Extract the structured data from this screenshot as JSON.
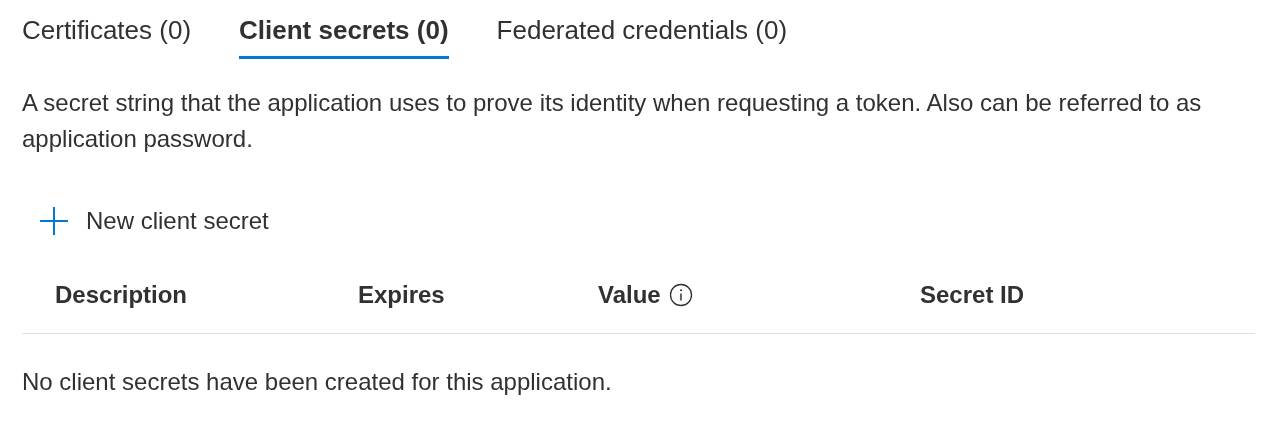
{
  "tabs": [
    {
      "label": "Certificates (0)",
      "selected": false
    },
    {
      "label": "Client secrets (0)",
      "selected": true
    },
    {
      "label": "Federated credentials (0)",
      "selected": false
    }
  ],
  "description": "A secret string that the application uses to prove its identity when requesting a token. Also can be referred to as application password.",
  "new_button": {
    "label": "New client secret"
  },
  "table": {
    "columns": [
      {
        "label": "Description",
        "info": false
      },
      {
        "label": "Expires",
        "info": false
      },
      {
        "label": "Value",
        "info": true
      },
      {
        "label": "Secret ID",
        "info": false
      }
    ],
    "empty_message": "No client secrets have been created for this application."
  }
}
